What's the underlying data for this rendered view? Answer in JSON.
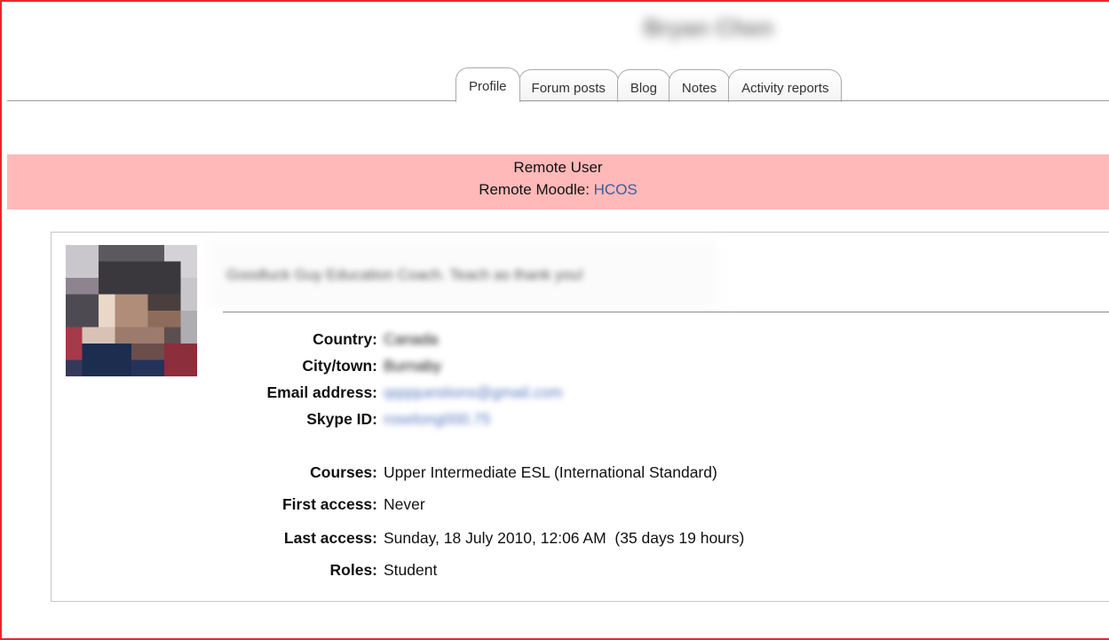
{
  "header": {
    "user_name": "Bryan Chen"
  },
  "tabs": [
    {
      "label": "Profile",
      "active": true
    },
    {
      "label": "Forum posts",
      "active": false
    },
    {
      "label": "Blog",
      "active": false
    },
    {
      "label": "Notes",
      "active": false
    },
    {
      "label": "Activity reports",
      "active": false
    }
  ],
  "remote": {
    "title": "Remote User",
    "moodle_label": "Remote Moodle: ",
    "moodle_link": "HCOS"
  },
  "profile": {
    "description": "Goodluck Guy Education Coach. Teach as thank you!",
    "fields": {
      "country": {
        "label": "Country:",
        "value": "Canada"
      },
      "city": {
        "label": "City/town:",
        "value": "Burnaby"
      },
      "email": {
        "label": "Email address:",
        "value": "qqqquestions@gmail.com"
      },
      "skype": {
        "label": "Skype ID:",
        "value": "roselong000.75"
      },
      "courses": {
        "label": "Courses:",
        "value": "Upper Intermediate ESL (International Standard)"
      },
      "first_access": {
        "label": "First access:",
        "value": "Never"
      },
      "last_access": {
        "label": "Last access:",
        "value": "Sunday, 18 July 2010, 12:06 AM  (35 days 19 hours)"
      },
      "roles": {
        "label": "Roles:",
        "value": "Student"
      }
    }
  },
  "colors": {
    "frame_border": "#e8262b",
    "remote_bar": "#ffb9b9",
    "link": "#3d5b9a"
  }
}
